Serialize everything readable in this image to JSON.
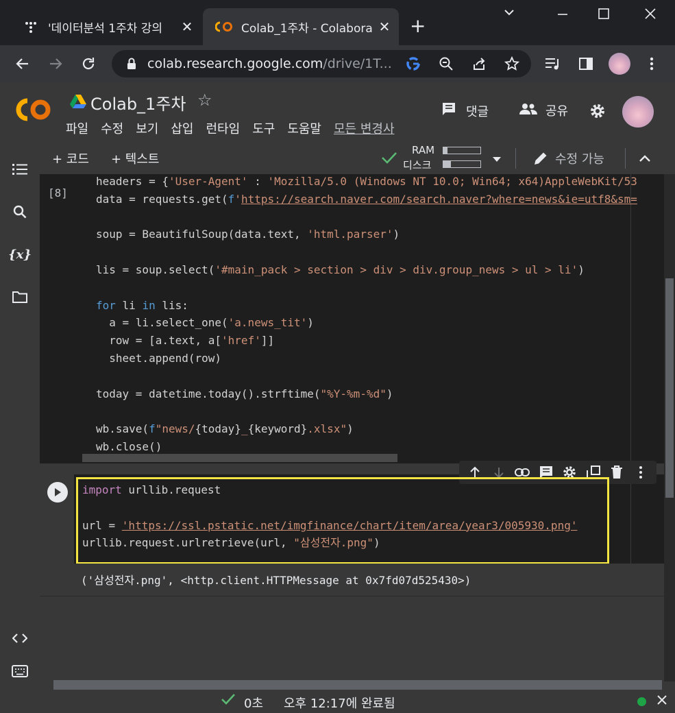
{
  "browser": {
    "tabs": [
      {
        "title": "'데이터분석 1주차 강의",
        "active": false
      },
      {
        "title": "Colab_1주차 - Colabora",
        "active": true
      }
    ],
    "new_tab_label": "+",
    "url_main": "colab.research.google.com",
    "url_rest": "/drive/1T..."
  },
  "colab": {
    "logo_text": "CO",
    "notebook_title": "Colab_1주차",
    "menu": [
      "파일",
      "수정",
      "보기",
      "삽입",
      "런타임",
      "도구",
      "도움말"
    ],
    "changes_link": "모든 변경사",
    "comment_label": "댓글",
    "share_label": "공유",
    "toolbar": {
      "add_code": "+ 코드",
      "add_text": "+ 텍스트",
      "ram_label": "RAM",
      "disk_label": "디스크",
      "ram_usage": 0.12,
      "disk_usage": 0.2,
      "edit_mode": "수정 가능"
    }
  },
  "cells": {
    "cell1": {
      "exec_count": "[8]",
      "lines": [
        "headers = {'User-Agent' : 'Mozilla/5.0 (Windows NT 10.0; Win64; x64)AppleWebKit/53",
        "data = requests.get(f'https://search.naver.com/search.naver?where=news&ie=utf8&sm=",
        "",
        "soup = BeautifulSoup(data.text, 'html.parser')",
        "",
        "lis = soup.select('#main_pack > section > div > div.group_news > ul > li')",
        "",
        "for li in lis:",
        "  a = li.select_one('a.news_tit')",
        "  row = [a.text, a['href']]",
        "  sheet.append(row)",
        "",
        "today = datetime.today().strftime(\"%Y-%m-%d\")",
        "",
        "wb.save(f\"news/{today}_{keyword}.xlsx\")",
        "wb.close()"
      ]
    },
    "cell2": {
      "line1_kw": "import",
      "line1_rest": " urllib.request",
      "line2_pre": "url = ",
      "line2_url": "'https://ssl.pstatic.net/imgfinance/chart/item/area/year3/005930.png'",
      "line3_pre": "urllib.request.urlretrieve(url, ",
      "line3_str": "\"삼성전자.png\"",
      "line3_post": ")",
      "output": "('삼성전자.png', <http.client.HTTPMessage at 0x7fd07d525430>)"
    }
  },
  "status": {
    "duration": "0초",
    "completed": "오후 12:17에 완료됨"
  }
}
